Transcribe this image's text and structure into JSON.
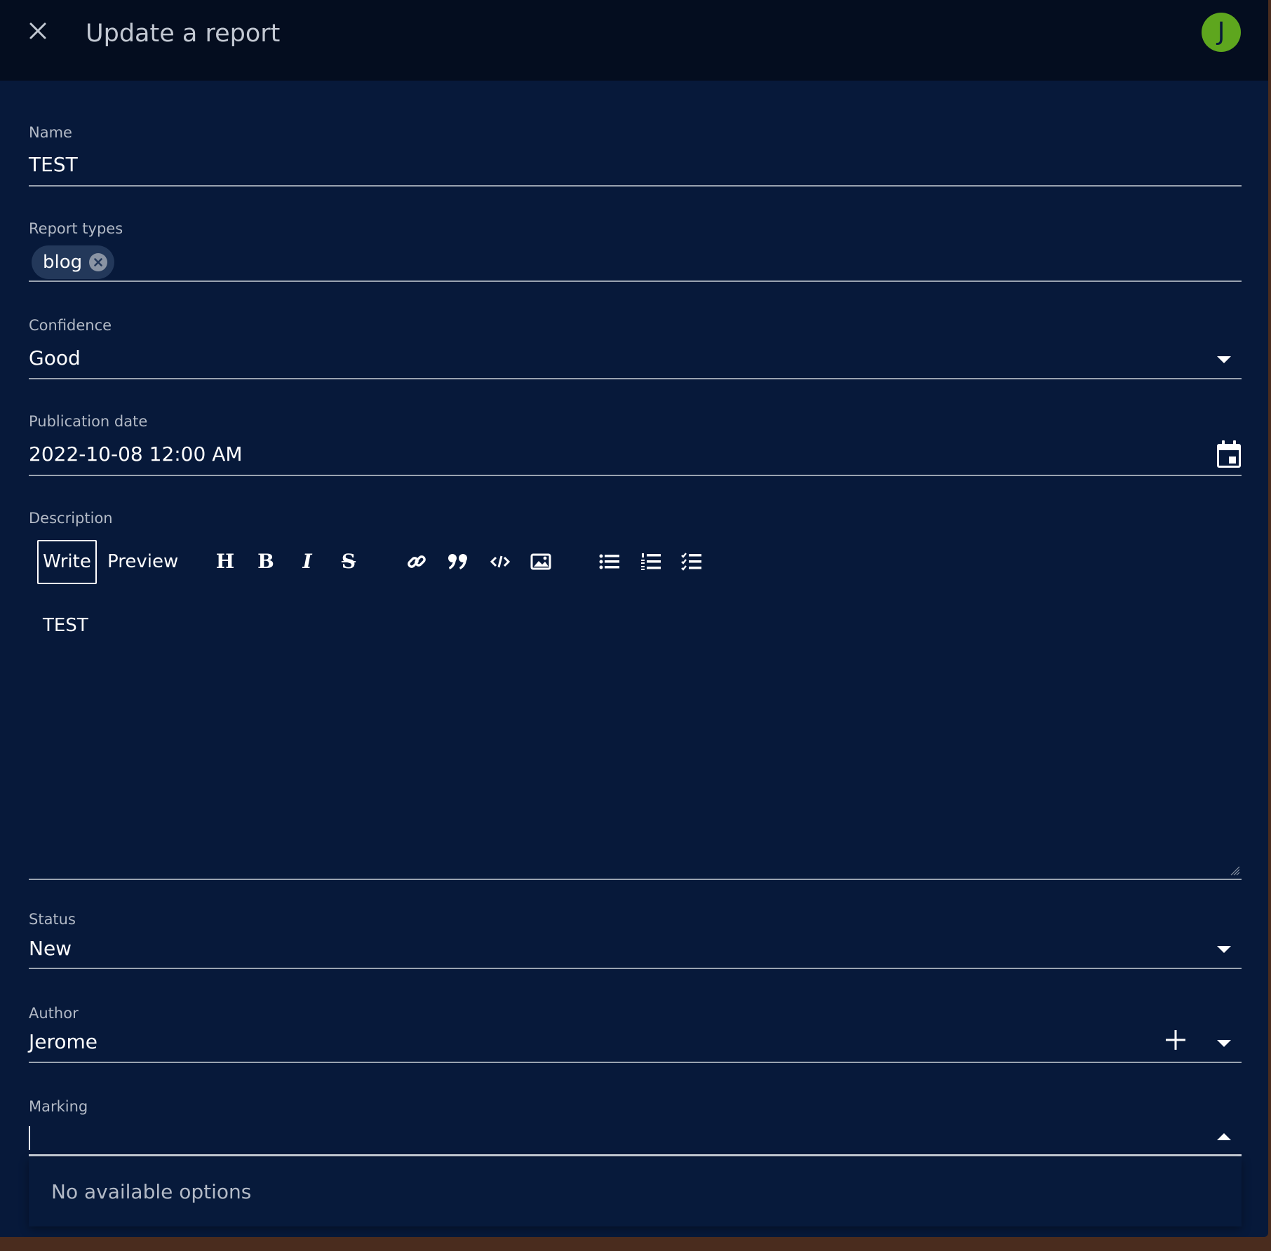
{
  "header": {
    "title": "Update a report",
    "avatar_initial": "J",
    "avatar_color": "#5ea61e"
  },
  "fields": {
    "name": {
      "label": "Name",
      "value": "TEST"
    },
    "report_types": {
      "label": "Report types",
      "chips": [
        "blog"
      ]
    },
    "confidence": {
      "label": "Confidence",
      "value": "Good"
    },
    "publication_date": {
      "label": "Publication date",
      "value": "2022-10-08 12:00 AM"
    },
    "description": {
      "label": "Description",
      "tabs": {
        "write": "Write",
        "preview": "Preview"
      },
      "tools": {
        "heading": "H",
        "bold": "B",
        "italic": "I",
        "strikethrough": "S"
      },
      "value": "TEST"
    },
    "status": {
      "label": "Status",
      "value": "New"
    },
    "author": {
      "label": "Author",
      "value": "Jerome"
    },
    "marking": {
      "label": "Marking",
      "value": "",
      "empty_text": "No available options"
    }
  },
  "icons": {
    "close": "close-icon",
    "calendar": "calendar-icon",
    "chip_delete": "cancel-circle-icon",
    "link": "link-icon",
    "quote": "quote-icon",
    "code": "code-icon",
    "image": "image-icon",
    "bullet_list": "bulleted-list-icon",
    "numbered_list": "numbered-list-icon",
    "checklist": "checklist-icon",
    "add": "plus-icon",
    "dropdown": "chevron-down-icon"
  },
  "colors": {
    "background": "#07193a",
    "header": "#040d1f",
    "chip": "#23385a"
  }
}
